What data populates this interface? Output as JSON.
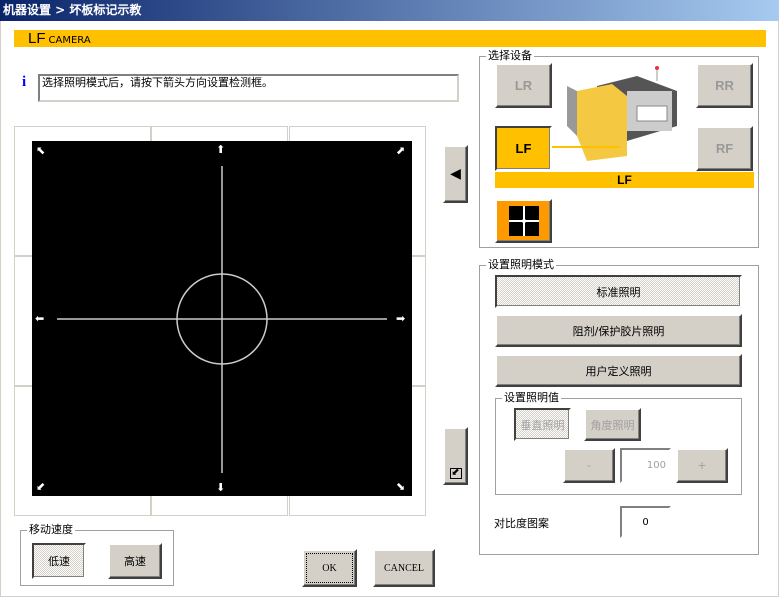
{
  "title": "机器设置 > 坏板标记示教",
  "camera_bar": {
    "id": "LF",
    "label": "CAMERA"
  },
  "message": "选择照明模式后，请按下箭头方向设置检测框。",
  "device_group": {
    "legend": "选择设备",
    "buttons": [
      "LR",
      "RR",
      "LF",
      "RF"
    ],
    "selected": "LF",
    "selected_label": "LF"
  },
  "lighting_group": {
    "legend": "设置照明模式",
    "modes": [
      "标准照明",
      "阻剂/保护胶片照明",
      "用户定义照明"
    ],
    "value_group": {
      "legend": "设置照明值",
      "vertical": "垂直照明",
      "angle": "角度照明",
      "minus": "-",
      "value": "100",
      "plus": "+"
    }
  },
  "contrast": {
    "label": "对比度图案",
    "value": "0"
  },
  "speed_group": {
    "legend": "移动速度",
    "low": "低速",
    "high": "高速"
  },
  "ok": "OK",
  "cancel": "CANCEL",
  "colors": {
    "accent": "#ffc000",
    "orange": "#ff9900"
  }
}
